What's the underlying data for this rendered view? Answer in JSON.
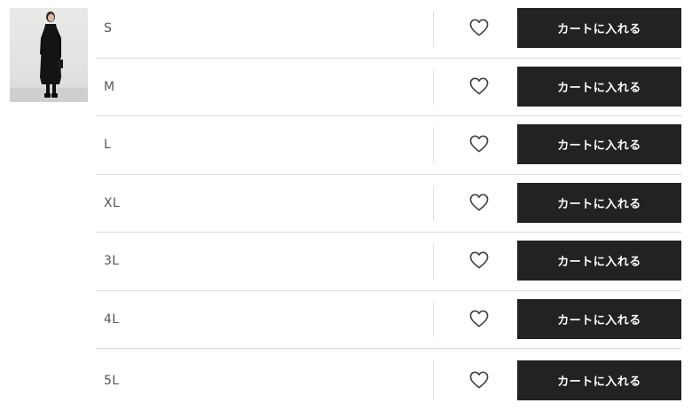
{
  "product": {
    "image_alt": "black long coat product image"
  },
  "rows": [
    {
      "size": "S",
      "cart_label": "カートに入れる",
      "favorite_icon": "heart-outline-icon"
    },
    {
      "size": "M",
      "cart_label": "カートに入れる",
      "favorite_icon": "heart-outline-icon"
    },
    {
      "size": "L",
      "cart_label": "カートに入れる",
      "favorite_icon": "heart-outline-icon"
    },
    {
      "size": "XL",
      "cart_label": "カートに入れる",
      "favorite_icon": "heart-outline-icon"
    },
    {
      "size": "3L",
      "cart_label": "カートに入れる",
      "favorite_icon": "heart-outline-icon"
    },
    {
      "size": "4L",
      "cart_label": "カートに入れる",
      "favorite_icon": "heart-outline-icon"
    },
    {
      "size": "5L",
      "cart_label": "カートに入れる",
      "favorite_icon": "heart-outline-icon"
    }
  ],
  "colors": {
    "button_bg": "#222222",
    "button_text": "#ffffff",
    "size_text": "#555555",
    "row_border": "#dcdcdc"
  }
}
